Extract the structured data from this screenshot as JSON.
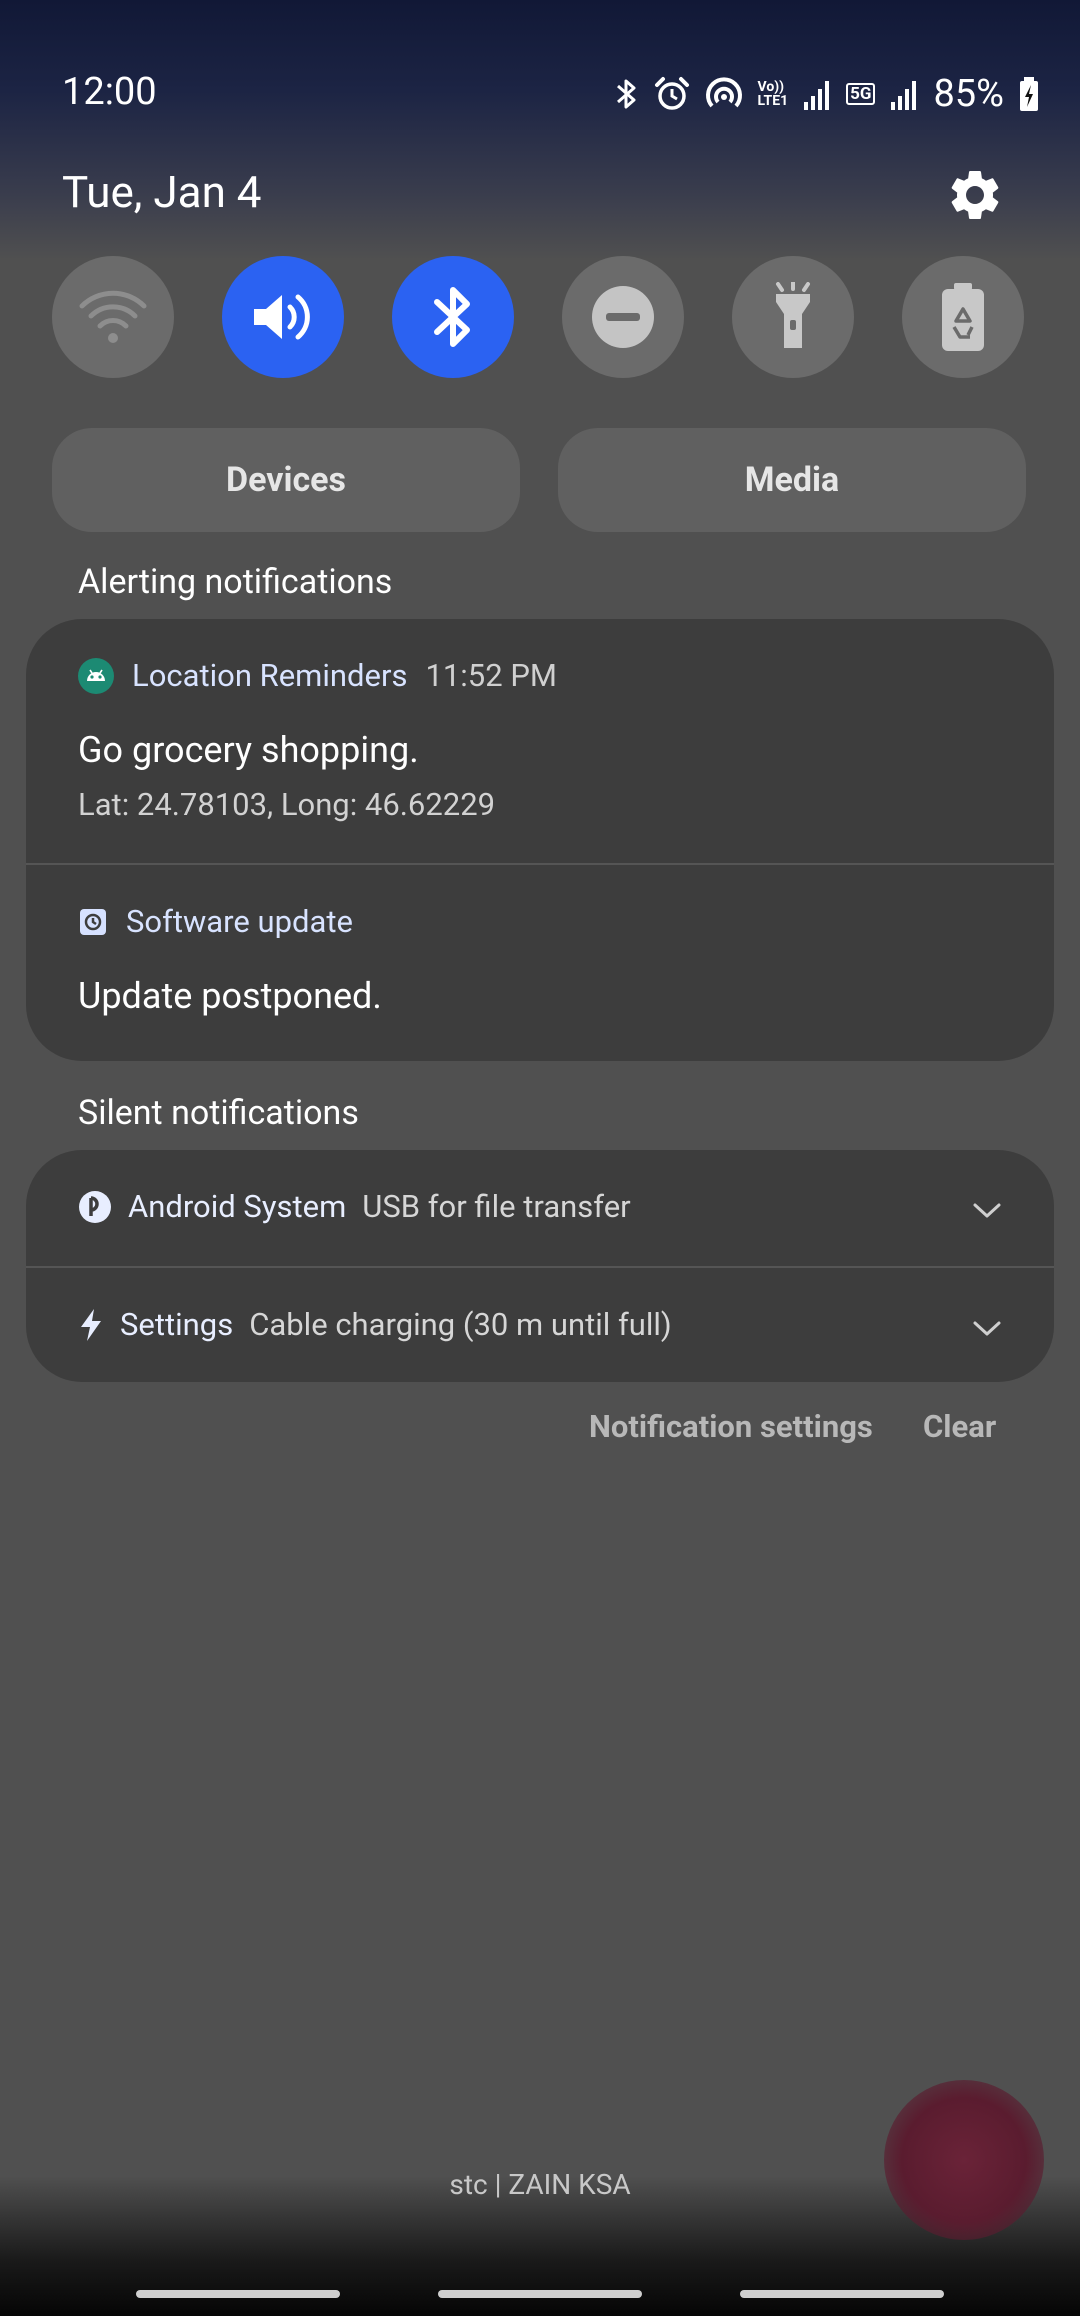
{
  "status_bar": {
    "time": "12:00",
    "volte_label": "Vo))\nLTE1",
    "five_g_label": "5G",
    "battery": "85%"
  },
  "header": {
    "date": "Tue, Jan 4"
  },
  "quick_settings": [
    {
      "name": "wifi",
      "active": false
    },
    {
      "name": "sound",
      "active": true
    },
    {
      "name": "bluetooth",
      "active": true
    },
    {
      "name": "do-not-disturb",
      "active": false
    },
    {
      "name": "flashlight",
      "active": false
    },
    {
      "name": "power-saving",
      "active": false
    }
  ],
  "panel_buttons": {
    "devices": "Devices",
    "media": "Media"
  },
  "alerting": {
    "section_label": "Alerting notifications",
    "items": [
      {
        "app": "Location Reminders",
        "time": "11:52 PM",
        "title": "Go grocery shopping.",
        "text": "Lat: 24.78103, Long: 46.62229"
      },
      {
        "app": "Software update",
        "title": "Update postponed."
      }
    ]
  },
  "silent": {
    "section_label": "Silent notifications",
    "items": [
      {
        "app": "Android System",
        "text": "USB for file transfer"
      },
      {
        "app": "Settings",
        "text": "Cable charging (30 m until full)"
      }
    ]
  },
  "actions": {
    "notification_settings": "Notification settings",
    "clear": "Clear"
  },
  "carrier": "stc | ZAIN KSA",
  "colors": {
    "accent": "#2b62f2",
    "card": "#3d3d3d",
    "background": "#505050"
  }
}
